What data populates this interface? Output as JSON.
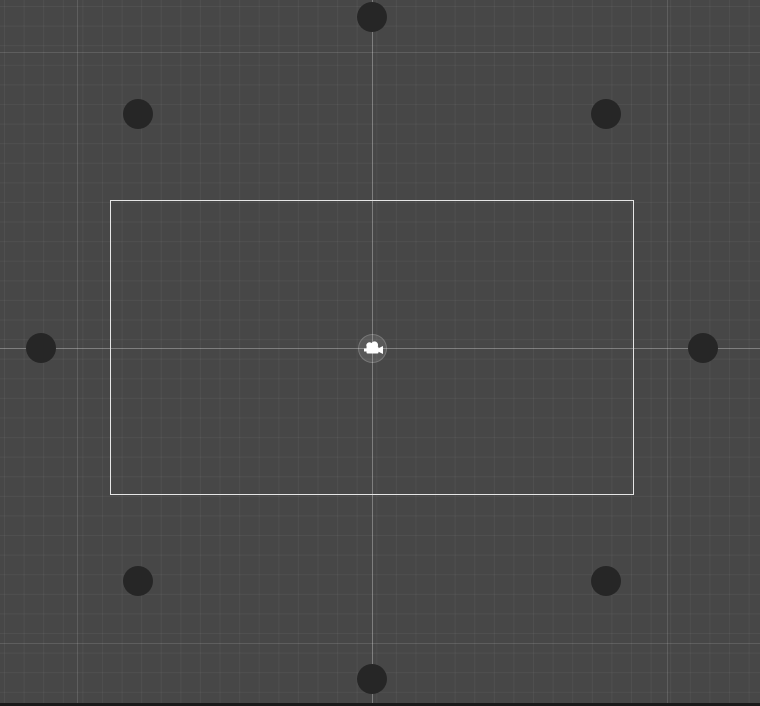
{
  "scene": {
    "tool": "camera-bounds-editor",
    "background_color": "#474747",
    "frame_color": "#e6e6e6",
    "handle_color": "#262626"
  },
  "camera_gizmo": {
    "icon": "camera-icon"
  },
  "handles": [
    "top",
    "top-left",
    "top-right",
    "left",
    "right",
    "bottom-left",
    "bottom-right",
    "bottom"
  ]
}
